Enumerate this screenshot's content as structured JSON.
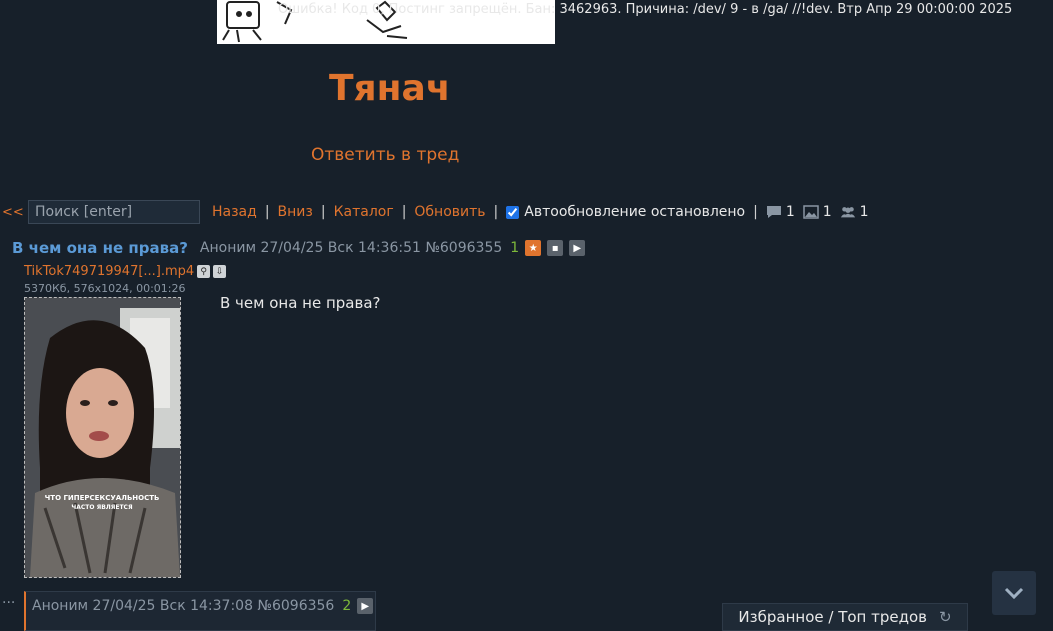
{
  "banner": {
    "message": "Ошибка! Код 0, Постинг запрещён. Бан: 3462963. Причина: /dev/ 9 - в /ga/ //!dev. Втр Апр 29 00:00:00 2025"
  },
  "board": {
    "title": "Тянач",
    "reply_link": "Ответить в тред"
  },
  "navbar": {
    "back": "<<",
    "search_placeholder": "Поиск [enter]",
    "links": [
      "Назад",
      "Вниз",
      "Каталог",
      "Обновить"
    ],
    "autoupdate_label": "Автообновление остановлено",
    "autoupdate_checked": true,
    "stats": {
      "posts": "1",
      "files": "1",
      "posters": "1"
    }
  },
  "op": {
    "subject": "В чем она не права?",
    "meta": "Аноним 27/04/25 Вск 14:36:51 №6096355",
    "replies": "1",
    "file": {
      "name": "TikTok749719947[...].mp4",
      "info": "5370Кб, 576x1024, 00:01:26",
      "caption_line1": "ЧТО ГИПЕРСЕКСУАЛЬНОСТЬ",
      "caption_line2": "ЧАСТО ЯВЛЯЕТСЯ"
    },
    "body": "В чем она не права?"
  },
  "reply": {
    "dots": "...",
    "meta": "Аноним 27/04/25 Вск 14:37:08 №6096356",
    "replies": "2"
  },
  "fav_panel": {
    "label": "Избранное / Топ тредов"
  },
  "colors": {
    "background": "#17202a",
    "accent": "#e0742e",
    "subject": "#5b9ad6",
    "reply_count": "#7db83a"
  }
}
